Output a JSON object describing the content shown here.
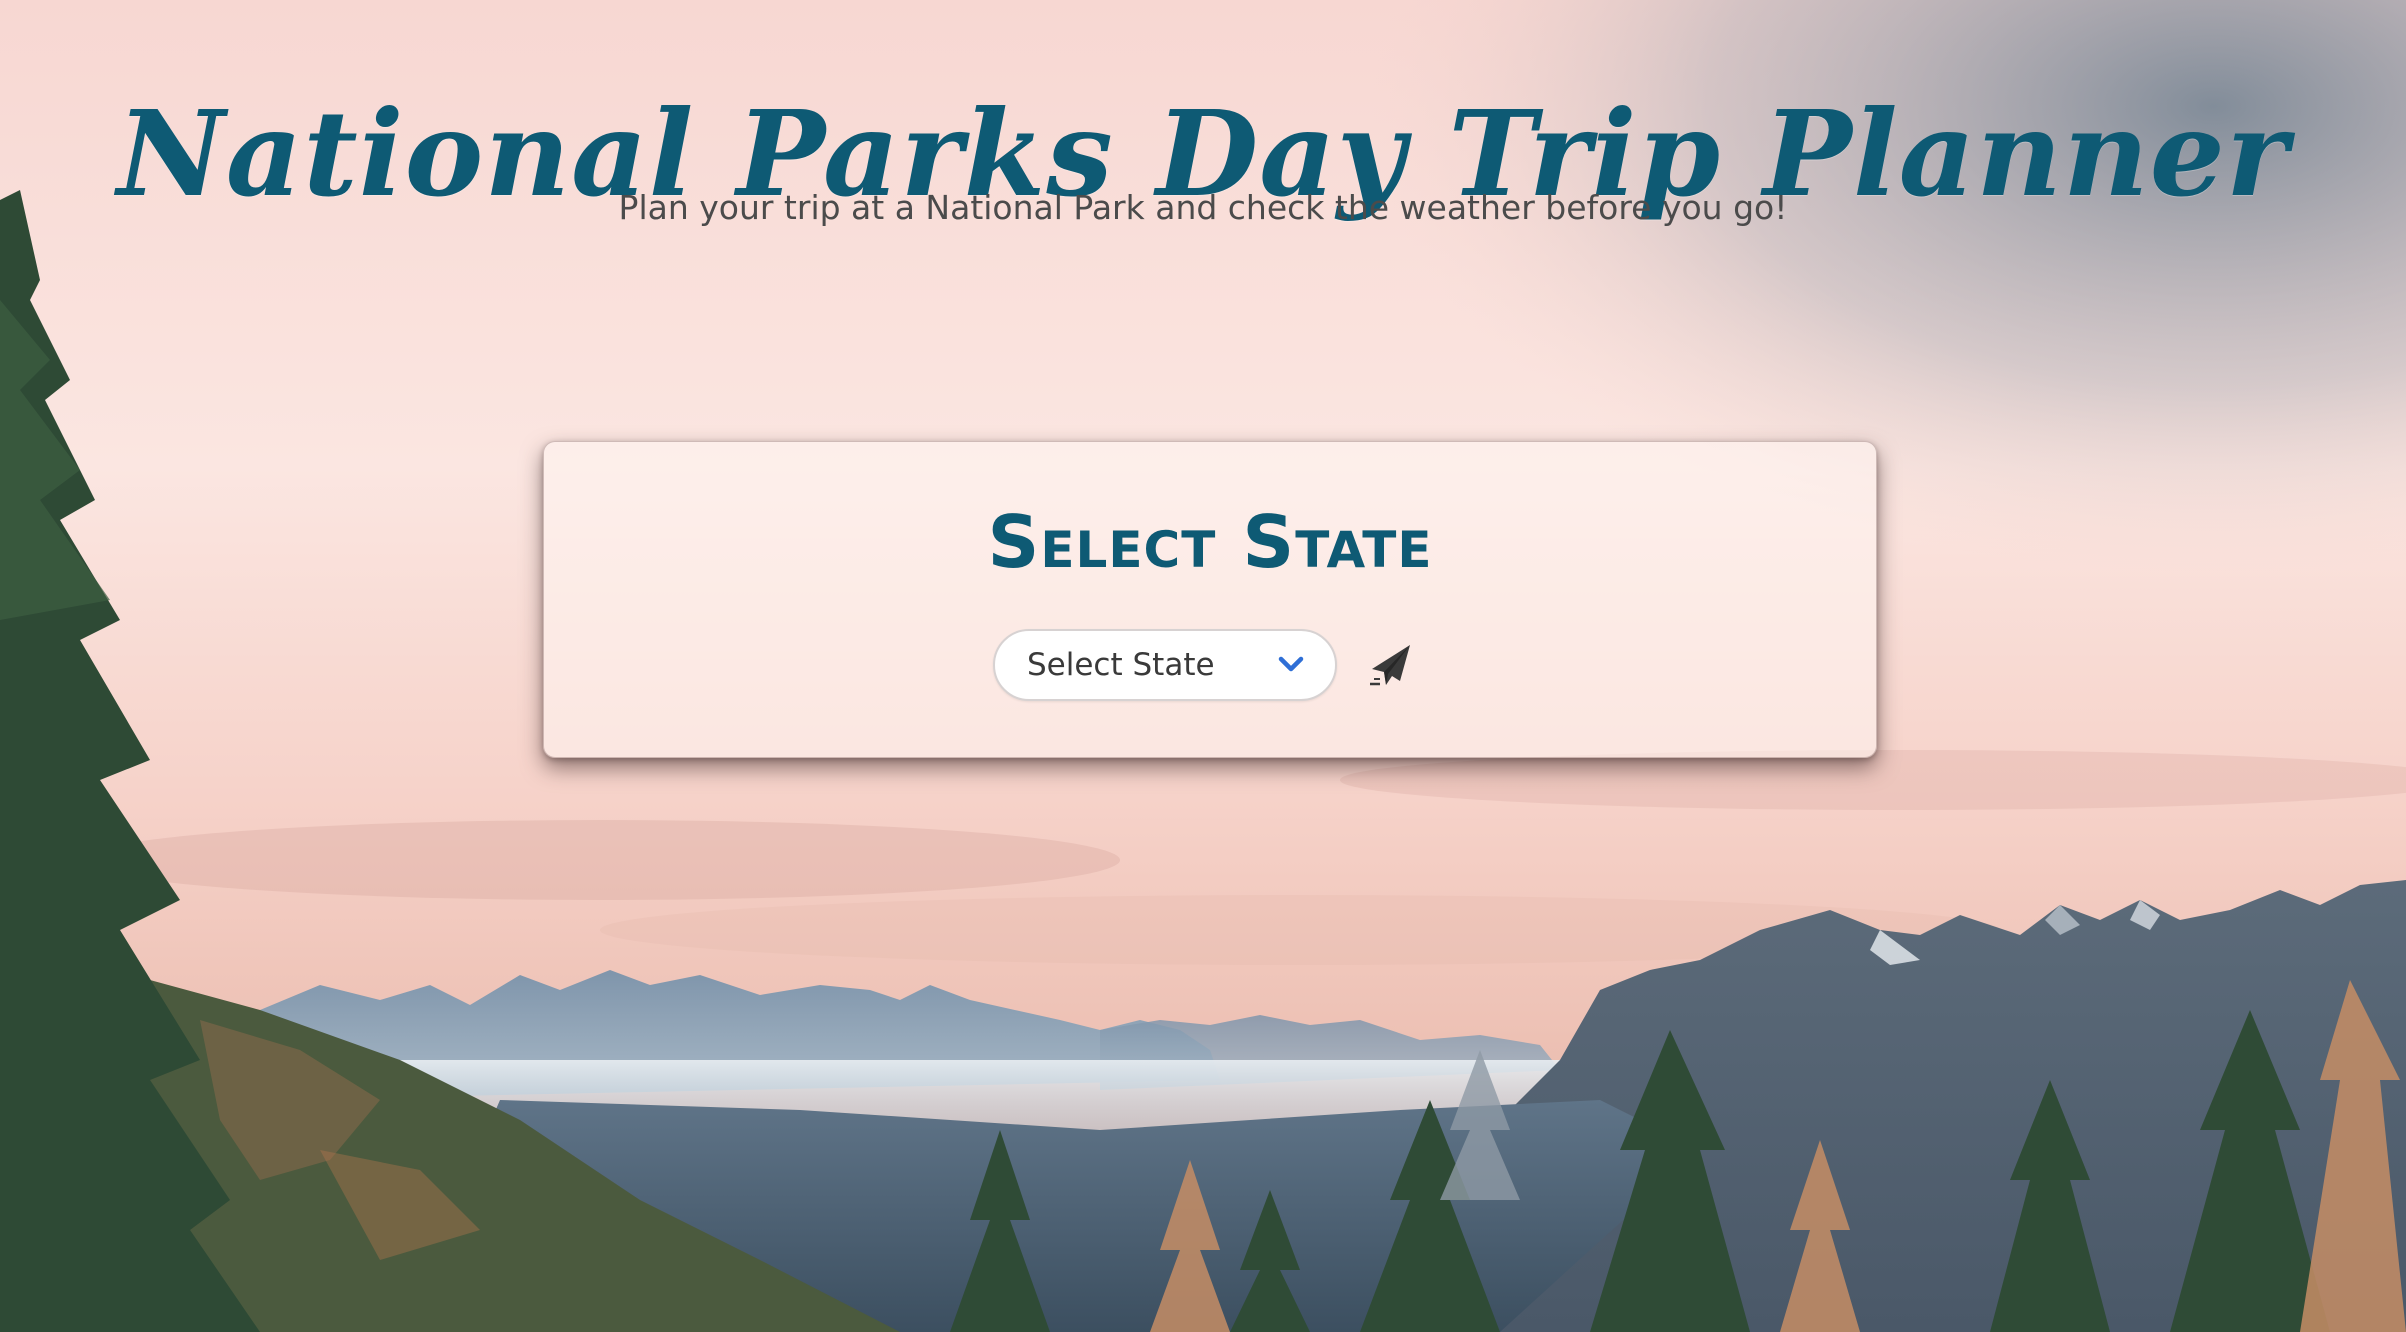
{
  "page": {
    "title": "National Parks Day Trip Planner",
    "subtitle": "Plan your trip at a National Park and check the weather before you go!"
  },
  "card": {
    "heading": "Select State",
    "state_select": {
      "selected_value": "Select State",
      "icon": "chevron-down-icon"
    },
    "submit": {
      "icon": "paper-plane-icon"
    }
  },
  "colors": {
    "accent": "#0e5a74",
    "subtitle_text": "#4b4b4b",
    "chevron": "#2f6fd6"
  },
  "background": {
    "description_icon": "mountain-landscape-image"
  }
}
